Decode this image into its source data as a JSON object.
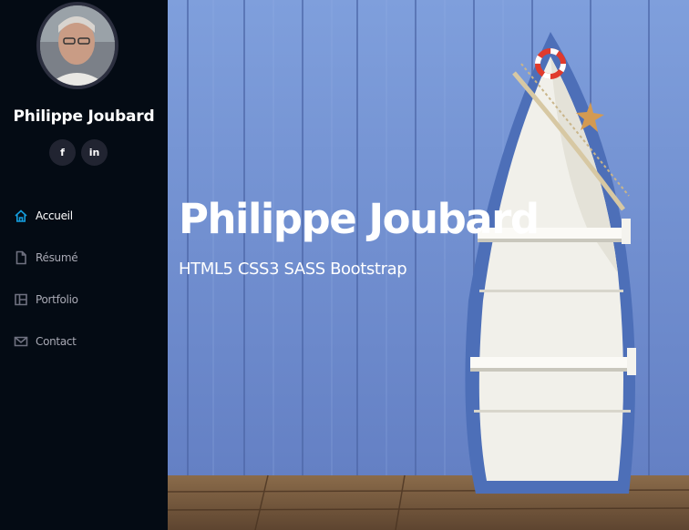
{
  "sidebar": {
    "profile_name": "Philippe Joubard",
    "social": [
      {
        "label": "f",
        "icon": "facebook-icon"
      },
      {
        "label": "in",
        "icon": "linkedin-icon"
      }
    ],
    "nav": [
      {
        "label": "Accueil",
        "icon": "home-icon",
        "active": true
      },
      {
        "label": "Résumé",
        "icon": "file-icon",
        "active": false
      },
      {
        "label": "Portfolio",
        "icon": "portfolio-icon",
        "active": false
      },
      {
        "label": "Contact",
        "icon": "envelope-icon",
        "active": false
      }
    ]
  },
  "hero": {
    "title": "Philippe Joubard",
    "subtitle": "HTML5 CSS3 SASS Bootstrap"
  },
  "colors": {
    "sidebar_bg": "#040b14",
    "accent": "#149ddd",
    "hero_wall": "#6d8fd0"
  }
}
